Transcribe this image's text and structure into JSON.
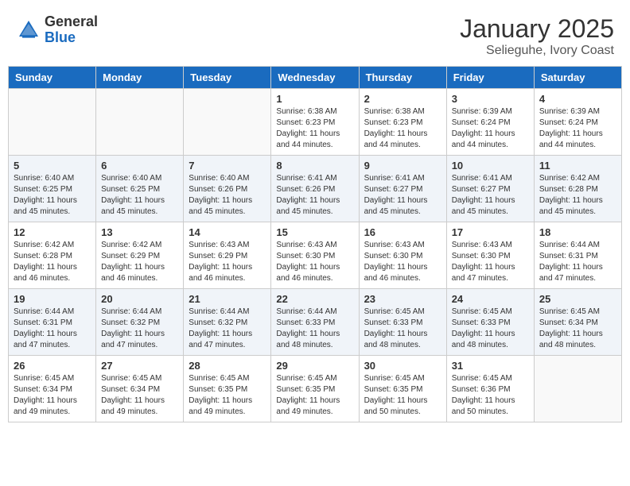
{
  "header": {
    "logo_general": "General",
    "logo_blue": "Blue",
    "month_title": "January 2025",
    "location": "Selieguhe, Ivory Coast"
  },
  "days_of_week": [
    "Sunday",
    "Monday",
    "Tuesday",
    "Wednesday",
    "Thursday",
    "Friday",
    "Saturday"
  ],
  "weeks": [
    [
      {
        "day": "",
        "sunrise": "",
        "sunset": "",
        "daylight": ""
      },
      {
        "day": "",
        "sunrise": "",
        "sunset": "",
        "daylight": ""
      },
      {
        "day": "",
        "sunrise": "",
        "sunset": "",
        "daylight": ""
      },
      {
        "day": "1",
        "sunrise": "Sunrise: 6:38 AM",
        "sunset": "Sunset: 6:23 PM",
        "daylight": "Daylight: 11 hours and 44 minutes."
      },
      {
        "day": "2",
        "sunrise": "Sunrise: 6:38 AM",
        "sunset": "Sunset: 6:23 PM",
        "daylight": "Daylight: 11 hours and 44 minutes."
      },
      {
        "day": "3",
        "sunrise": "Sunrise: 6:39 AM",
        "sunset": "Sunset: 6:24 PM",
        "daylight": "Daylight: 11 hours and 44 minutes."
      },
      {
        "day": "4",
        "sunrise": "Sunrise: 6:39 AM",
        "sunset": "Sunset: 6:24 PM",
        "daylight": "Daylight: 11 hours and 44 minutes."
      }
    ],
    [
      {
        "day": "5",
        "sunrise": "Sunrise: 6:40 AM",
        "sunset": "Sunset: 6:25 PM",
        "daylight": "Daylight: 11 hours and 45 minutes."
      },
      {
        "day": "6",
        "sunrise": "Sunrise: 6:40 AM",
        "sunset": "Sunset: 6:25 PM",
        "daylight": "Daylight: 11 hours and 45 minutes."
      },
      {
        "day": "7",
        "sunrise": "Sunrise: 6:40 AM",
        "sunset": "Sunset: 6:26 PM",
        "daylight": "Daylight: 11 hours and 45 minutes."
      },
      {
        "day": "8",
        "sunrise": "Sunrise: 6:41 AM",
        "sunset": "Sunset: 6:26 PM",
        "daylight": "Daylight: 11 hours and 45 minutes."
      },
      {
        "day": "9",
        "sunrise": "Sunrise: 6:41 AM",
        "sunset": "Sunset: 6:27 PM",
        "daylight": "Daylight: 11 hours and 45 minutes."
      },
      {
        "day": "10",
        "sunrise": "Sunrise: 6:41 AM",
        "sunset": "Sunset: 6:27 PM",
        "daylight": "Daylight: 11 hours and 45 minutes."
      },
      {
        "day": "11",
        "sunrise": "Sunrise: 6:42 AM",
        "sunset": "Sunset: 6:28 PM",
        "daylight": "Daylight: 11 hours and 45 minutes."
      }
    ],
    [
      {
        "day": "12",
        "sunrise": "Sunrise: 6:42 AM",
        "sunset": "Sunset: 6:28 PM",
        "daylight": "Daylight: 11 hours and 46 minutes."
      },
      {
        "day": "13",
        "sunrise": "Sunrise: 6:42 AM",
        "sunset": "Sunset: 6:29 PM",
        "daylight": "Daylight: 11 hours and 46 minutes."
      },
      {
        "day": "14",
        "sunrise": "Sunrise: 6:43 AM",
        "sunset": "Sunset: 6:29 PM",
        "daylight": "Daylight: 11 hours and 46 minutes."
      },
      {
        "day": "15",
        "sunrise": "Sunrise: 6:43 AM",
        "sunset": "Sunset: 6:30 PM",
        "daylight": "Daylight: 11 hours and 46 minutes."
      },
      {
        "day": "16",
        "sunrise": "Sunrise: 6:43 AM",
        "sunset": "Sunset: 6:30 PM",
        "daylight": "Daylight: 11 hours and 46 minutes."
      },
      {
        "day": "17",
        "sunrise": "Sunrise: 6:43 AM",
        "sunset": "Sunset: 6:30 PM",
        "daylight": "Daylight: 11 hours and 47 minutes."
      },
      {
        "day": "18",
        "sunrise": "Sunrise: 6:44 AM",
        "sunset": "Sunset: 6:31 PM",
        "daylight": "Daylight: 11 hours and 47 minutes."
      }
    ],
    [
      {
        "day": "19",
        "sunrise": "Sunrise: 6:44 AM",
        "sunset": "Sunset: 6:31 PM",
        "daylight": "Daylight: 11 hours and 47 minutes."
      },
      {
        "day": "20",
        "sunrise": "Sunrise: 6:44 AM",
        "sunset": "Sunset: 6:32 PM",
        "daylight": "Daylight: 11 hours and 47 minutes."
      },
      {
        "day": "21",
        "sunrise": "Sunrise: 6:44 AM",
        "sunset": "Sunset: 6:32 PM",
        "daylight": "Daylight: 11 hours and 47 minutes."
      },
      {
        "day": "22",
        "sunrise": "Sunrise: 6:44 AM",
        "sunset": "Sunset: 6:33 PM",
        "daylight": "Daylight: 11 hours and 48 minutes."
      },
      {
        "day": "23",
        "sunrise": "Sunrise: 6:45 AM",
        "sunset": "Sunset: 6:33 PM",
        "daylight": "Daylight: 11 hours and 48 minutes."
      },
      {
        "day": "24",
        "sunrise": "Sunrise: 6:45 AM",
        "sunset": "Sunset: 6:33 PM",
        "daylight": "Daylight: 11 hours and 48 minutes."
      },
      {
        "day": "25",
        "sunrise": "Sunrise: 6:45 AM",
        "sunset": "Sunset: 6:34 PM",
        "daylight": "Daylight: 11 hours and 48 minutes."
      }
    ],
    [
      {
        "day": "26",
        "sunrise": "Sunrise: 6:45 AM",
        "sunset": "Sunset: 6:34 PM",
        "daylight": "Daylight: 11 hours and 49 minutes."
      },
      {
        "day": "27",
        "sunrise": "Sunrise: 6:45 AM",
        "sunset": "Sunset: 6:34 PM",
        "daylight": "Daylight: 11 hours and 49 minutes."
      },
      {
        "day": "28",
        "sunrise": "Sunrise: 6:45 AM",
        "sunset": "Sunset: 6:35 PM",
        "daylight": "Daylight: 11 hours and 49 minutes."
      },
      {
        "day": "29",
        "sunrise": "Sunrise: 6:45 AM",
        "sunset": "Sunset: 6:35 PM",
        "daylight": "Daylight: 11 hours and 49 minutes."
      },
      {
        "day": "30",
        "sunrise": "Sunrise: 6:45 AM",
        "sunset": "Sunset: 6:35 PM",
        "daylight": "Daylight: 11 hours and 50 minutes."
      },
      {
        "day": "31",
        "sunrise": "Sunrise: 6:45 AM",
        "sunset": "Sunset: 6:36 PM",
        "daylight": "Daylight: 11 hours and 50 minutes."
      },
      {
        "day": "",
        "sunrise": "",
        "sunset": "",
        "daylight": ""
      }
    ]
  ]
}
